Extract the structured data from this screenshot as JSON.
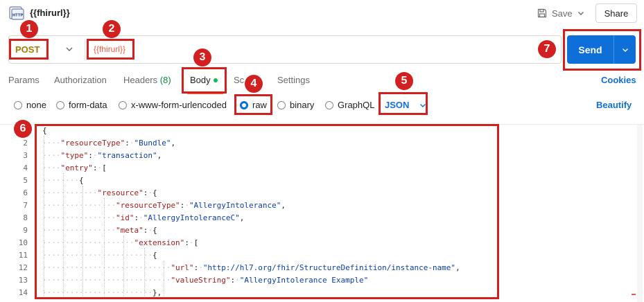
{
  "header": {
    "icon": "http-icon",
    "title": "{{fhirurl}}",
    "save_label": "Save",
    "share_label": "Share"
  },
  "request": {
    "method": "POST",
    "url": "{{fhirurl}}",
    "send_label": "Send"
  },
  "tabs": {
    "params": "Params",
    "authorization": "Authorization",
    "headers": "Headers",
    "headers_count": "(8)",
    "body": "Body",
    "scripts_partial": "Sc",
    "settings": "Settings",
    "cookies": "Cookies"
  },
  "body_types": {
    "none": "none",
    "form_data": "form-data",
    "urlencoded": "x-www-form-urlencoded",
    "raw": "raw",
    "binary": "binary",
    "graphql": "GraphQL",
    "selected": "raw",
    "format": "JSON",
    "beautify": "Beautify"
  },
  "editor": {
    "line_numbers": [
      "2",
      "3",
      "4",
      "5",
      "6",
      "7",
      "8",
      "9",
      "10",
      "11",
      "12",
      "13",
      "14"
    ],
    "first_line": "{",
    "resourceType_key": "\"resourceType\"",
    "bundle_val": "\"Bundle\"",
    "type_key": "\"type\"",
    "transaction_val": "\"transaction\"",
    "entry_key": "\"entry\"",
    "resource_key": "\"resource\"",
    "allergy_val": "\"AllergyIntolerance\"",
    "id_key": "\"id\"",
    "id_val": "\"AllergyIntoleranceC\"",
    "meta_key": "\"meta\"",
    "extension_key": "\"extension\"",
    "url_key": "\"url\"",
    "url_val": "\"http://hl7.org/fhir/StructureDefinition/instance-name\"",
    "valueString_key": "\"valueString\"",
    "valueString_val": "\"AllergyIntolerance Example\""
  },
  "annotations": [
    "1",
    "2",
    "3",
    "4",
    "5",
    "6",
    "7"
  ],
  "colors": {
    "accent": "#0f6fd9",
    "annotation": "#d21f1f",
    "method": "#a67c00",
    "url": "#e05a47",
    "json_key": "#a21d1d",
    "json_string": "#0e3ea8"
  }
}
